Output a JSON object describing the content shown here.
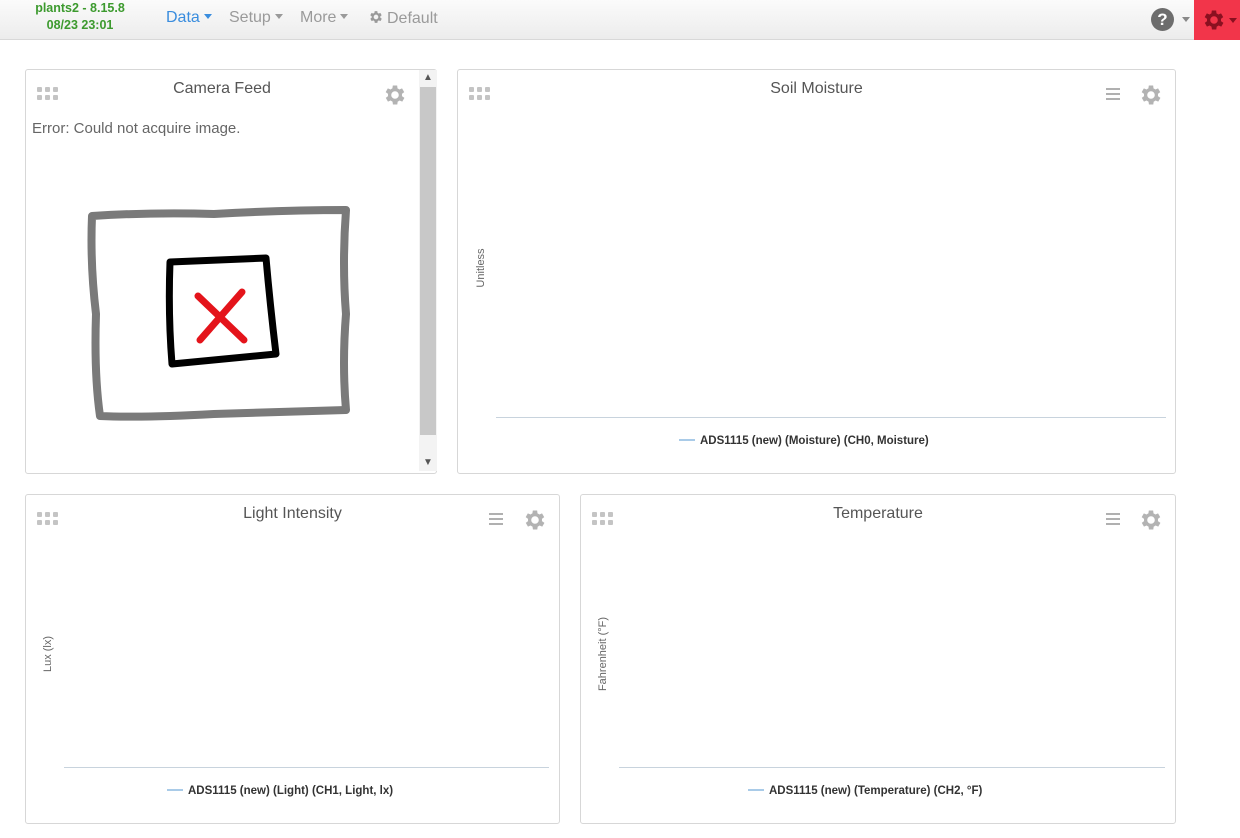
{
  "app": {
    "host_version": "plants2 - 8.15.8",
    "datetime": "08/23 23:01"
  },
  "nav": {
    "items": [
      {
        "label": "Data",
        "active": true
      },
      {
        "label": "Setup",
        "active": false
      },
      {
        "label": "More",
        "active": false
      }
    ],
    "dashboard_label": "Default",
    "help_label": "?"
  },
  "colors": {
    "brand_green": "#3c9a2e",
    "active_link": "#3a8dde",
    "settings_red": "#f2354a",
    "legend_line": "#a9cbe8"
  },
  "widgets": {
    "camera": {
      "title": "Camera Feed",
      "error_text": "Error: Could not acquire image.",
      "icon": "image-unavailable-icon"
    },
    "soil": {
      "title": "Soil Moisture",
      "y_label": "Unitless",
      "legend": "ADS1115 (new) (Moisture) (CH0, Moisture)"
    },
    "light": {
      "title": "Light Intensity",
      "y_label": "Lux (lx)",
      "legend": "ADS1115 (new) (Light) (CH1, Light, lx)"
    },
    "temp": {
      "title": "Temperature",
      "y_label": "Fahrenheit (°F)",
      "legend": "ADS1115 (new) (Temperature) (CH2, °F)"
    }
  }
}
